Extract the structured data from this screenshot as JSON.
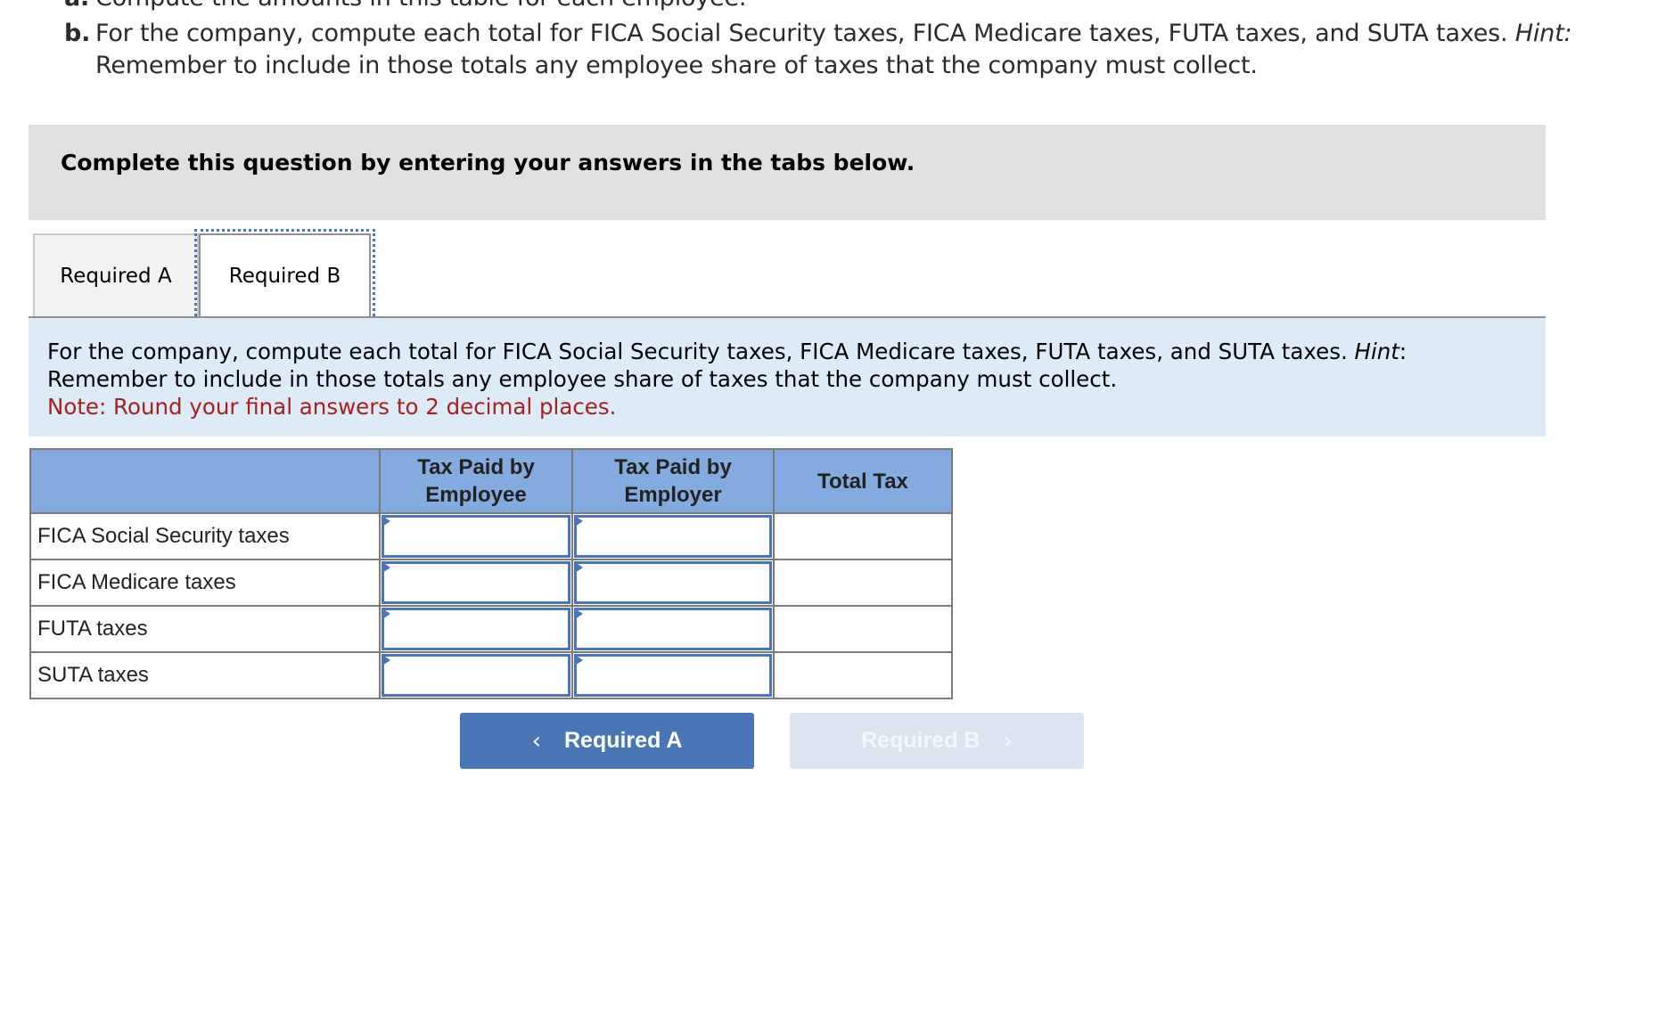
{
  "question": {
    "part_a": {
      "lead": "a.",
      "text": "Compute the amounts in this table for each employee."
    },
    "part_b": {
      "lead": "b.",
      "text": "For the company, compute each total for FICA Social Security taxes, FICA Medicare taxes, FUTA taxes, and SUTA taxes. ",
      "hint_label": "Hint:",
      "line2": "Remember to include in those totals any employee share of taxes that the company must collect."
    }
  },
  "instructions": "Complete this question by entering your answers in the tabs below.",
  "tabs": [
    {
      "label": "Required A",
      "active": false
    },
    {
      "label": "Required B",
      "active": true
    }
  ],
  "prompt": {
    "line1": "For the company, compute each total for FICA Social Security taxes, FICA Medicare taxes, FUTA taxes, and SUTA taxes. ",
    "hint_label": "Hint",
    "hint_colon": ":",
    "line2": "Remember to include in those totals any employee share of taxes that the company must collect.",
    "note": "Note: Round your final answers to 2 decimal places.",
    "note_color": "#a7201f"
  },
  "table": {
    "headers": [
      "",
      "Tax Paid by Employee",
      "Tax Paid by Employer",
      "Total Tax"
    ],
    "header_lines": {
      "employee": [
        "Tax Paid by",
        "Employee"
      ],
      "employer": [
        "Tax Paid by",
        "Employer"
      ],
      "total": "Total Tax"
    },
    "rows": [
      {
        "label": "FICA Social Security taxes",
        "employee": "",
        "employer": "",
        "total": ""
      },
      {
        "label": "FICA Medicare taxes",
        "employee": "",
        "employer": "",
        "total": ""
      },
      {
        "label": "FUTA taxes",
        "employee": "",
        "employer": "",
        "total": ""
      },
      {
        "label": "SUTA taxes",
        "employee": "",
        "employer": "",
        "total": ""
      }
    ],
    "header_color": "#84aadf",
    "input_border_color": "#4a76b8"
  },
  "navigation": {
    "prev": {
      "label": "Required A",
      "icon": "chevron-left-icon",
      "glyph": "‹",
      "enabled": true,
      "color": "#4a76b6"
    },
    "next": {
      "label": "Required B",
      "icon": "chevron-right-icon",
      "glyph": "›",
      "enabled": false,
      "color": "#dbe4ef"
    }
  }
}
